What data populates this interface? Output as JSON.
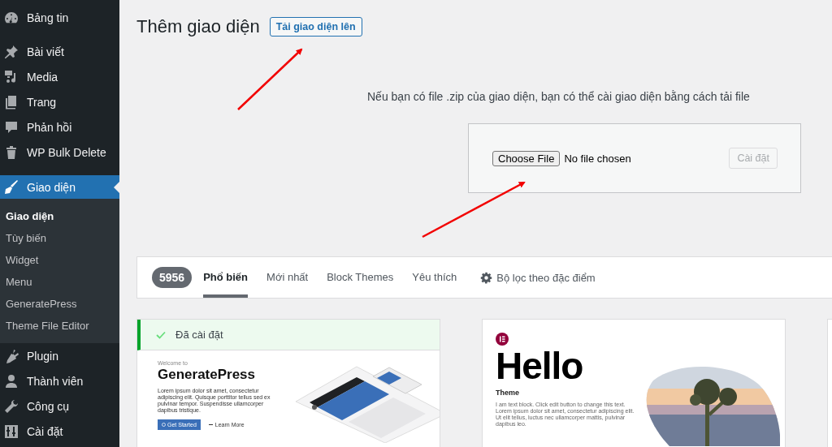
{
  "sidebar": {
    "items": [
      {
        "label": "Bảng tin",
        "selected": false
      },
      {
        "label": "Bài viết",
        "selected": false
      },
      {
        "label": "Media",
        "selected": false
      },
      {
        "label": "Trang",
        "selected": false
      },
      {
        "label": "Phản hồi",
        "selected": false
      },
      {
        "label": "WP Bulk Delete",
        "selected": false
      },
      {
        "label": "Giao diện",
        "selected": true,
        "children": [
          {
            "label": "Giao diện",
            "selected": true
          },
          {
            "label": "Tùy biến",
            "selected": false
          },
          {
            "label": "Widget",
            "selected": false
          },
          {
            "label": "Menu",
            "selected": false
          },
          {
            "label": "GeneratePress",
            "selected": false
          },
          {
            "label": "Theme File Editor",
            "selected": false
          }
        ]
      },
      {
        "label": "Plugin",
        "selected": false
      },
      {
        "label": "Thành viên",
        "selected": false
      },
      {
        "label": "Công cụ",
        "selected": false
      },
      {
        "label": "Cài đặt",
        "selected": false
      }
    ]
  },
  "header": {
    "title": "Thêm giao diện",
    "upload_button": "Tải giao diện lên"
  },
  "upload": {
    "description": "Nếu bạn có file .zip của giao diện, bạn có thể cài giao diện bằng cách tải file",
    "file_button": "Choose File",
    "file_status": "No file chosen",
    "install_button": {
      "label": "Cài đặt",
      "disabled": true
    }
  },
  "filter_bar": {
    "count": "5956",
    "tabs": [
      {
        "label": "Phổ biến",
        "selected": true
      },
      {
        "label": "Mới nhất",
        "selected": false
      },
      {
        "label": "Block Themes",
        "selected": false
      },
      {
        "label": "Yêu thích",
        "selected": false
      }
    ],
    "feature_filter": "Bộ lọc theo đặc điểm"
  },
  "themes": [
    {
      "kind": "generatepress",
      "installed": true,
      "installed_label": "Đã cài đặt",
      "preview": {
        "eyebrow": "Welcome to",
        "title": "GeneratePress",
        "text": "Lorem ipsum dolor sit amet, consectetur adipiscing elit. Quisque porttitor tellus sed ex pulvinar tempor. Suspendisse ullamcorper dapibus tristique.",
        "primary_button": "Get Started",
        "secondary_link": "Learn More"
      }
    },
    {
      "kind": "hello",
      "installed": false,
      "preview": {
        "title": "Hello",
        "subtitle": "Theme",
        "text": "I am text block. Click edit button to change this text. Lorem ipsum dolor sit amet, consectetur adipiscing elit. Ut elit tellus, luctus nec ullamcorper mattis, pulvinar dapibus leo."
      }
    },
    {
      "kind": "blank",
      "installed": false
    }
  ]
}
